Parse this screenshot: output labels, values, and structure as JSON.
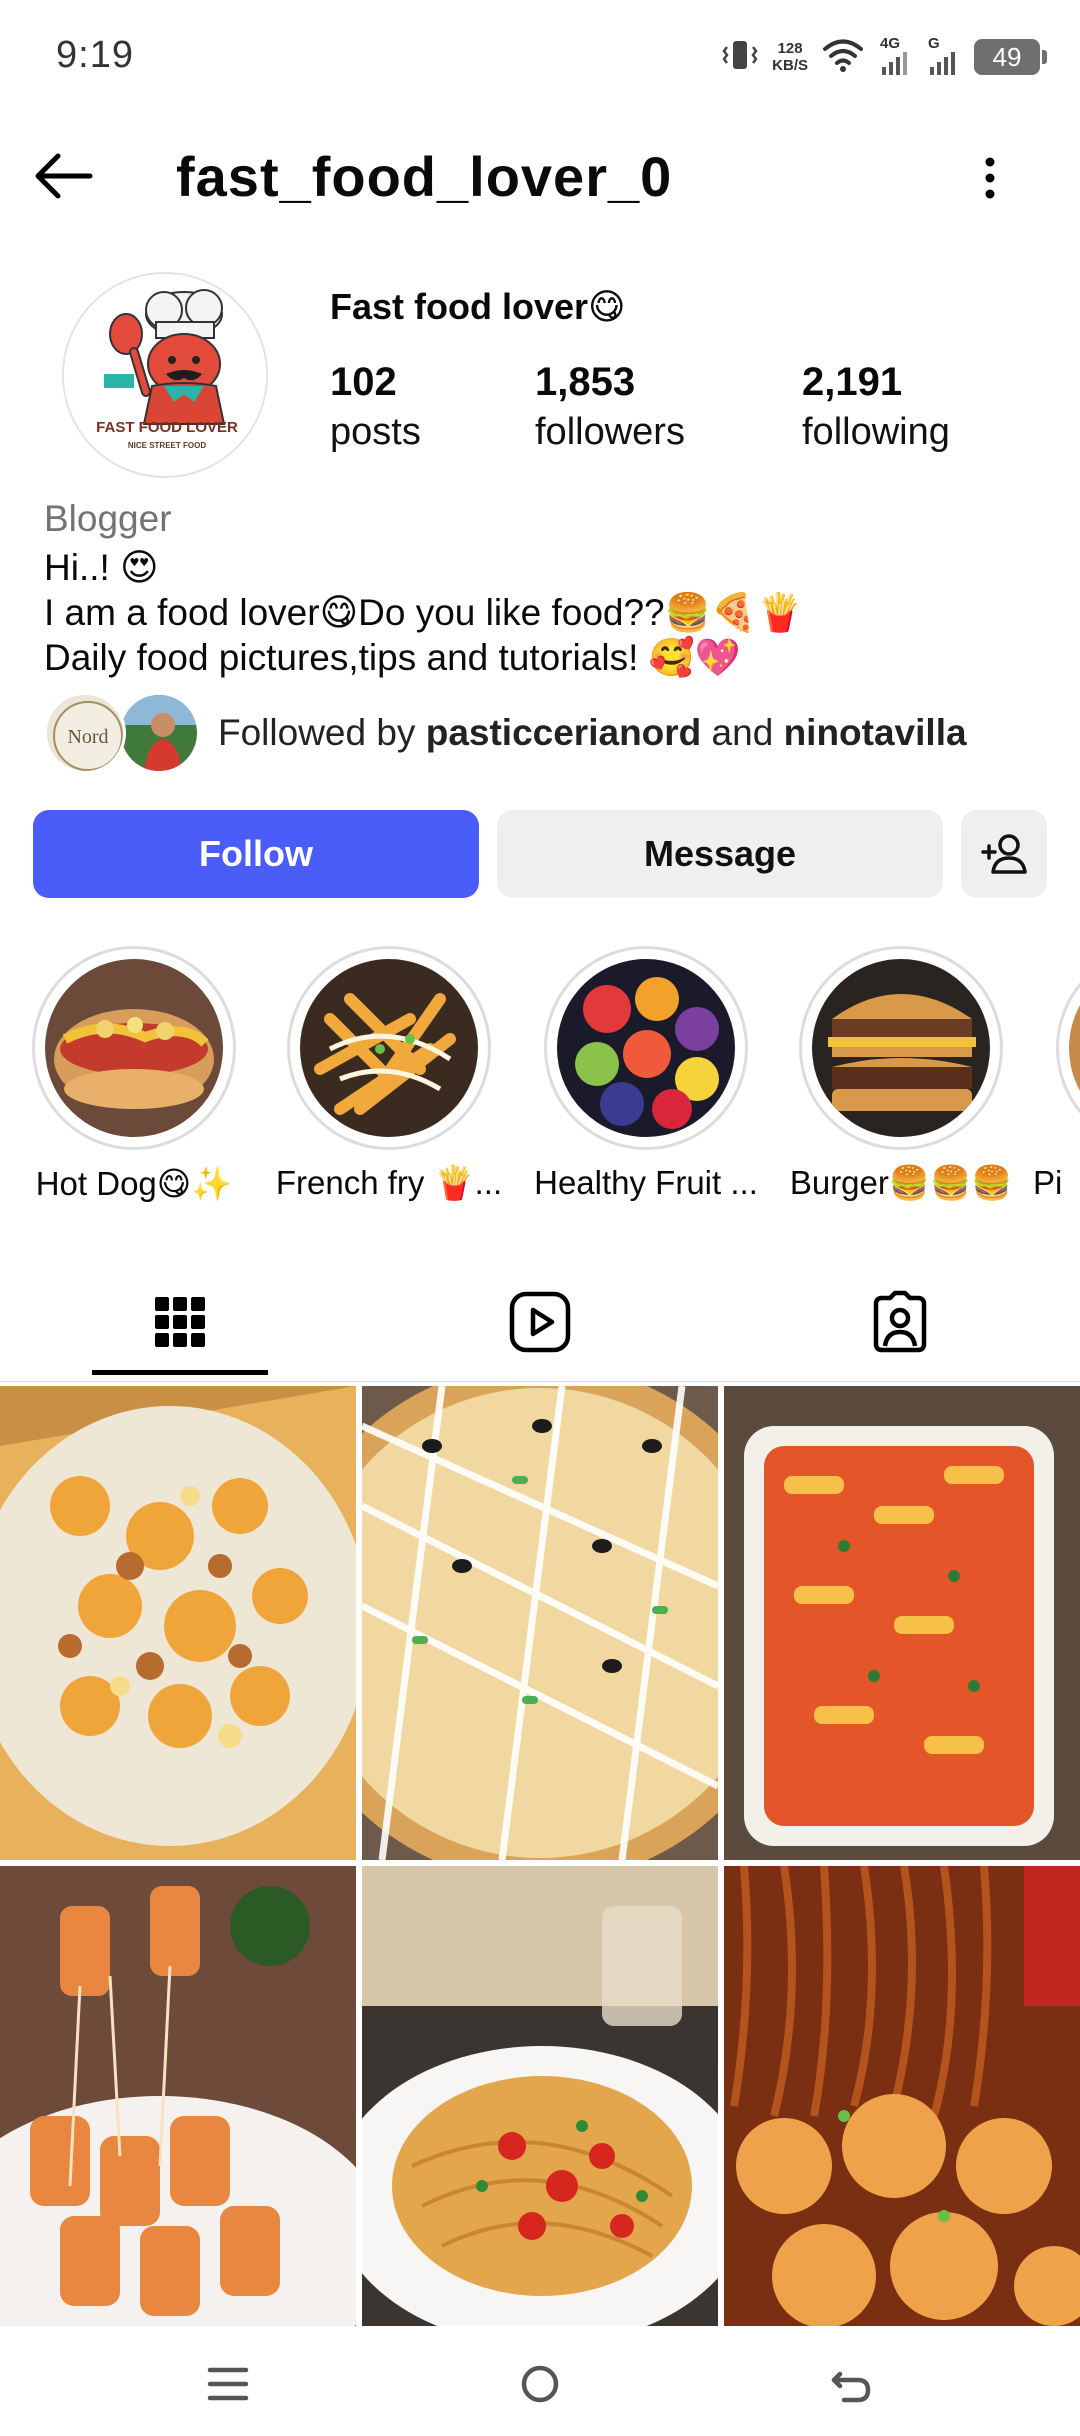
{
  "status_bar": {
    "time": "9:19",
    "net_speed_value": "128",
    "net_speed_unit": "KB/S",
    "net_type_1": "4G",
    "net_type_2": "G",
    "battery": "49"
  },
  "header": {
    "username": "fast_food_lover_0"
  },
  "profile": {
    "display_name": "Fast food lover😋",
    "avatar_text_1": "FAST FOOD LOVER",
    "avatar_text_2": "NICE STREET FOOD",
    "stats": [
      {
        "value": "102",
        "label": "posts"
      },
      {
        "value": "1,853",
        "label": "followers"
      },
      {
        "value": "2,191",
        "label": "following"
      }
    ],
    "category": "Blogger",
    "bio_lines": [
      "Hi..! 😍",
      "I am a food lover😋Do you like food??🍔🍕🍟",
      "Daily food pictures,tips and tutorials! 🥰💖"
    ],
    "followed_by_prefix": "Followed by ",
    "followed_by_user_1": "pasticcerianord",
    "followed_by_and": " and ",
    "followed_by_user_2": "ninotavilla",
    "follower_avatar_1_text": "Nord"
  },
  "actions": {
    "follow": "Follow",
    "message": "Message"
  },
  "highlights": [
    {
      "label": "Hot Dog😋✨",
      "icon": "hot-dog"
    },
    {
      "label": "French fry 🍟...",
      "icon": "french-fries"
    },
    {
      "label": "Healthy Fruit ...",
      "icon": "fruit-bowl"
    },
    {
      "label": "Burger🍔🍔🍔",
      "icon": "burger"
    },
    {
      "label": "Pi",
      "icon": "pizza"
    }
  ],
  "tabs": [
    {
      "name": "posts-grid-icon"
    },
    {
      "name": "reels-icon"
    },
    {
      "name": "tagged-icon"
    }
  ],
  "posts": [
    {
      "subject": "nachos"
    },
    {
      "subject": "pizza"
    },
    {
      "subject": "baked pasta"
    },
    {
      "subject": "rigatoni"
    },
    {
      "subject": "spaghetti"
    },
    {
      "subject": "noodles and chicken"
    }
  ],
  "colors": {
    "follow_button": "#4a5df9",
    "secondary_button": "#efeff2",
    "muted_text": "#737373"
  }
}
